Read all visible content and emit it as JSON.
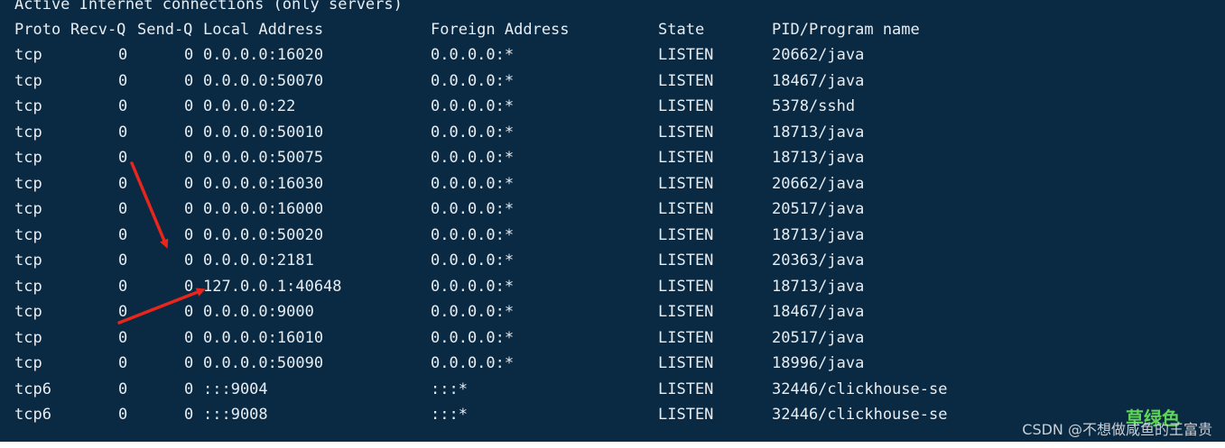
{
  "terminal": {
    "title": "Active Internet connections (only servers)",
    "headers": {
      "proto": "Proto",
      "recv": "Recv-Q",
      "send": "Send-Q",
      "local": "Local Address",
      "foreign": "Foreign Address",
      "state": "State",
      "pid": "PID/Program name"
    },
    "rows": [
      {
        "proto": "tcp",
        "recv": "0",
        "send": "0",
        "local": "0.0.0.0:16020",
        "foreign": "0.0.0.0:*",
        "state": "LISTEN",
        "pid": "20662/java"
      },
      {
        "proto": "tcp",
        "recv": "0",
        "send": "0",
        "local": "0.0.0.0:50070",
        "foreign": "0.0.0.0:*",
        "state": "LISTEN",
        "pid": "18467/java"
      },
      {
        "proto": "tcp",
        "recv": "0",
        "send": "0",
        "local": "0.0.0.0:22",
        "foreign": "0.0.0.0:*",
        "state": "LISTEN",
        "pid": "5378/sshd"
      },
      {
        "proto": "tcp",
        "recv": "0",
        "send": "0",
        "local": "0.0.0.0:50010",
        "foreign": "0.0.0.0:*",
        "state": "LISTEN",
        "pid": "18713/java"
      },
      {
        "proto": "tcp",
        "recv": "0",
        "send": "0",
        "local": "0.0.0.0:50075",
        "foreign": "0.0.0.0:*",
        "state": "LISTEN",
        "pid": "18713/java"
      },
      {
        "proto": "tcp",
        "recv": "0",
        "send": "0",
        "local": "0.0.0.0:16030",
        "foreign": "0.0.0.0:*",
        "state": "LISTEN",
        "pid": "20662/java"
      },
      {
        "proto": "tcp",
        "recv": "0",
        "send": "0",
        "local": "0.0.0.0:16000",
        "foreign": "0.0.0.0:*",
        "state": "LISTEN",
        "pid": "20517/java"
      },
      {
        "proto": "tcp",
        "recv": "0",
        "send": "0",
        "local": "0.0.0.0:50020",
        "foreign": "0.0.0.0:*",
        "state": "LISTEN",
        "pid": "18713/java"
      },
      {
        "proto": "tcp",
        "recv": "0",
        "send": "0",
        "local": "0.0.0.0:2181",
        "foreign": "0.0.0.0:*",
        "state": "LISTEN",
        "pid": "20363/java"
      },
      {
        "proto": "tcp",
        "recv": "0",
        "send": "0",
        "local": "127.0.0.1:40648",
        "foreign": "0.0.0.0:*",
        "state": "LISTEN",
        "pid": "18713/java"
      },
      {
        "proto": "tcp",
        "recv": "0",
        "send": "0",
        "local": "0.0.0.0:9000",
        "foreign": "0.0.0.0:*",
        "state": "LISTEN",
        "pid": "18467/java"
      },
      {
        "proto": "tcp",
        "recv": "0",
        "send": "0",
        "local": "0.0.0.0:16010",
        "foreign": "0.0.0.0:*",
        "state": "LISTEN",
        "pid": "20517/java"
      },
      {
        "proto": "tcp",
        "recv": "0",
        "send": "0",
        "local": "0.0.0.0:50090",
        "foreign": "0.0.0.0:*",
        "state": "LISTEN",
        "pid": "18996/java"
      },
      {
        "proto": "tcp6",
        "recv": "0",
        "send": "0",
        "local": ":::9004",
        "foreign": ":::*",
        "state": "LISTEN",
        "pid": "32446/clickhouse-se"
      },
      {
        "proto": "tcp6",
        "recv": "0",
        "send": "0",
        "local": ":::9008",
        "foreign": ":::*",
        "state": "LISTEN",
        "pid": "32446/clickhouse-se"
      }
    ]
  },
  "watermark": {
    "csdn": "CSDN @不想做咸鱼的王富贵",
    "green": "草绿色"
  },
  "colors": {
    "background": "#0a2a43",
    "text": "#e8edf2",
    "arrow": "#e8261c",
    "green_text": "#5fd35a"
  },
  "icons": {
    "annotations": [
      "arrow-icon",
      "arrow-icon"
    ]
  }
}
